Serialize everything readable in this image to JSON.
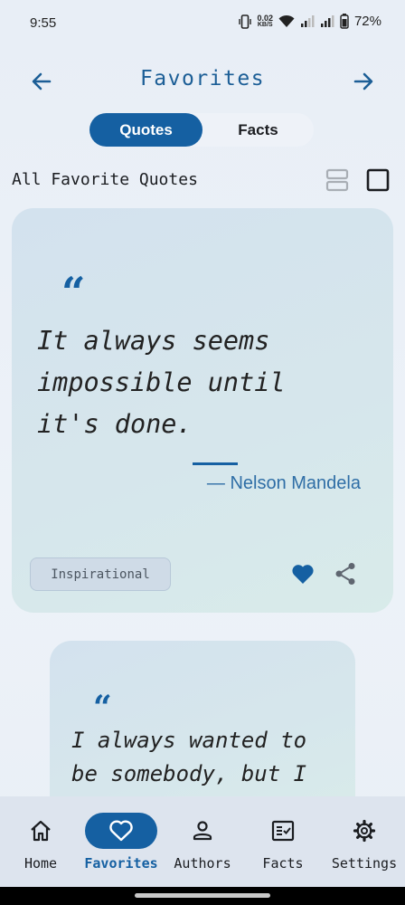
{
  "status_bar": {
    "time": "9:55",
    "net_speed_value": "0.02",
    "net_speed_unit": "KB/S",
    "battery": "72%",
    "icons": [
      "vibrate-icon",
      "wifi-icon",
      "signal-icon",
      "signal-icon",
      "battery-icon"
    ]
  },
  "app_bar": {
    "title": "Favorites",
    "back_icon": "arrow-left-icon",
    "forward_icon": "arrow-right-icon"
  },
  "segments": {
    "selected": "Quotes",
    "items": [
      {
        "label": "Quotes"
      },
      {
        "label": "Facts"
      }
    ]
  },
  "section": {
    "title": "All Favorite Quotes",
    "view_icons": [
      "list-view-icon",
      "single-view-icon"
    ]
  },
  "cards": [
    {
      "quote_mark": "“",
      "text": "It always seems impossible until it's done.",
      "author": "— Nelson Mandela",
      "tag": "Inspirational",
      "favorited": true
    },
    {
      "quote_mark": "“",
      "text": "I always wanted to be somebody, but I"
    }
  ],
  "bottom_nav": {
    "items": [
      {
        "label": "Home",
        "icon": "home-icon"
      },
      {
        "label": "Favorites",
        "icon": "heart-icon",
        "active": true
      },
      {
        "label": "Authors",
        "icon": "person-icon"
      },
      {
        "label": "Facts",
        "icon": "fact-check-icon"
      },
      {
        "label": "Settings",
        "icon": "gear-icon"
      }
    ]
  },
  "colors": {
    "accent": "#1560a2",
    "title": "#1c5e96",
    "nav_background": "#dde4ee"
  }
}
